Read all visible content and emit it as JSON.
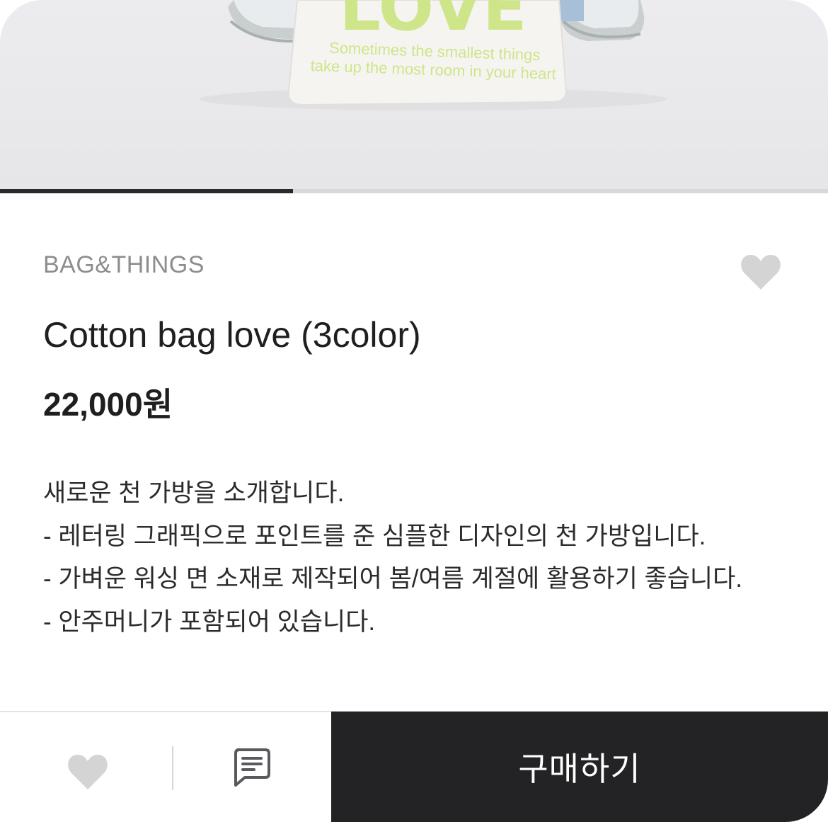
{
  "hero": {
    "bag_print_big": "LOVE",
    "bag_print_line1": "Sometimes the smallest things",
    "bag_print_line2": "take up the most room in your heart"
  },
  "carousel": {
    "progress": 0.354
  },
  "product": {
    "brand": "BAG&THINGS",
    "title": "Cotton bag love (3color)",
    "price": "22,000원",
    "description": [
      "새로운 천 가방을 소개합니다.",
      "- 레터링 그래픽으로 포인트를 준 심플한 디자인의 천 가방입니다.",
      "- 가벼운 워싱 면 소재로 제작되어 봄/여름 계절에 활용하기 좋습니다.",
      "- 안주머니가 포함되어 있습니다."
    ]
  },
  "icons": {
    "wishlist": "heart-icon",
    "like": "heart-icon",
    "comment": "chat-icon"
  },
  "bottom_bar": {
    "buy_label": "구매하기"
  },
  "colors": {
    "accent_dark": "#232326",
    "icon_gray": "#d4d4d4",
    "bag_print": "#cfe58a"
  }
}
